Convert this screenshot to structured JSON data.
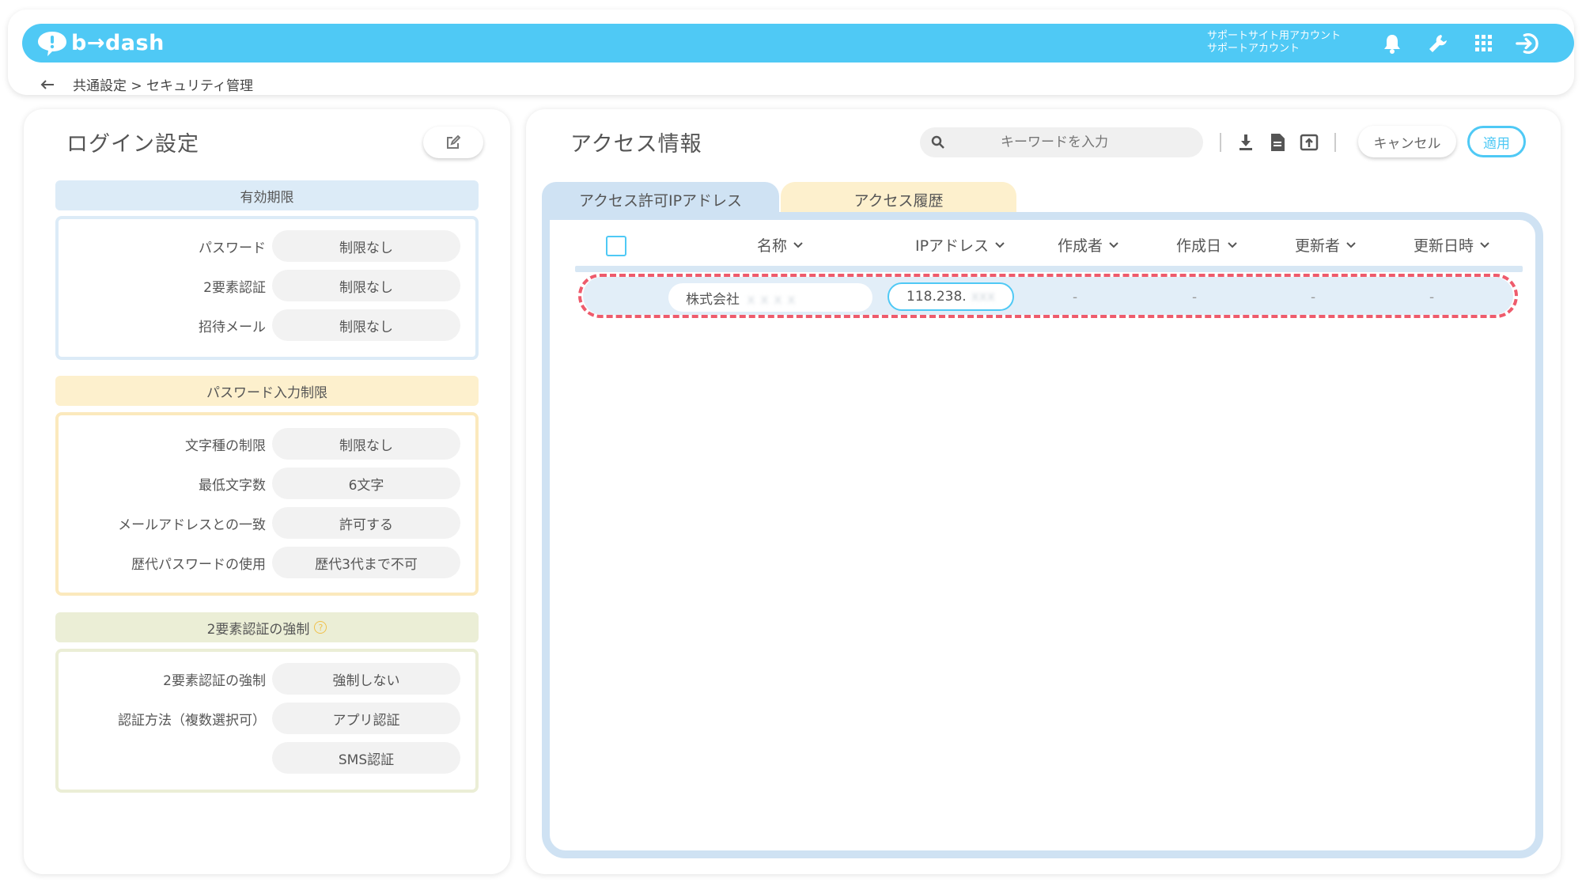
{
  "header": {
    "logo_text": "b→dash",
    "account_line1": "サポートサイト用アカウント",
    "account_line2": "サポートアカウント",
    "icons": [
      "bell-icon",
      "wrench-icon",
      "grid-icon",
      "logout-icon"
    ],
    "brand_color": "#4fc9f5"
  },
  "breadcrumb": {
    "path": "共通設定 > セキュリティ管理"
  },
  "login_settings": {
    "title": "ログイン設定",
    "sections": [
      {
        "head": "有効期限",
        "rows": [
          {
            "label": "パスワード",
            "value": "制限なし"
          },
          {
            "label": "2要素認証",
            "value": "制限なし"
          },
          {
            "label": "招待メール",
            "value": "制限なし"
          }
        ]
      },
      {
        "head": "パスワード入力制限",
        "rows": [
          {
            "label": "文字種の制限",
            "value": "制限なし"
          },
          {
            "label": "最低文字数",
            "value": "6文字"
          },
          {
            "label": "メールアドレスとの一致",
            "value": "許可する"
          },
          {
            "label": "歴代パスワードの使用",
            "value": "歴代3代まで不可"
          }
        ]
      },
      {
        "head": "2要素認証の強制",
        "rows": [
          {
            "label": "2要素認証の強制",
            "value": "強制しない"
          },
          {
            "label": "認証方法（複数選択可）",
            "value": "アプリ認証"
          },
          {
            "label": "",
            "value": "SMS認証"
          }
        ]
      }
    ]
  },
  "access_info": {
    "title": "アクセス情報",
    "search_placeholder": "キーワードを入力",
    "cancel_label": "キャンセル",
    "apply_label": "適用",
    "tabs": [
      "アクセス許可IPアドレス",
      "アクセス履歴"
    ],
    "columns": [
      "名称",
      "IPアドレス",
      "作成者",
      "作成日",
      "更新者",
      "更新日時"
    ],
    "rows": [
      {
        "name": "株式会社",
        "name_blurred": "ｘｘｘｘ",
        "ip": "118.238.",
        "ip_blurred": "xxx",
        "creator": "-",
        "created": "-",
        "updater": "-",
        "updated": "-"
      }
    ]
  }
}
